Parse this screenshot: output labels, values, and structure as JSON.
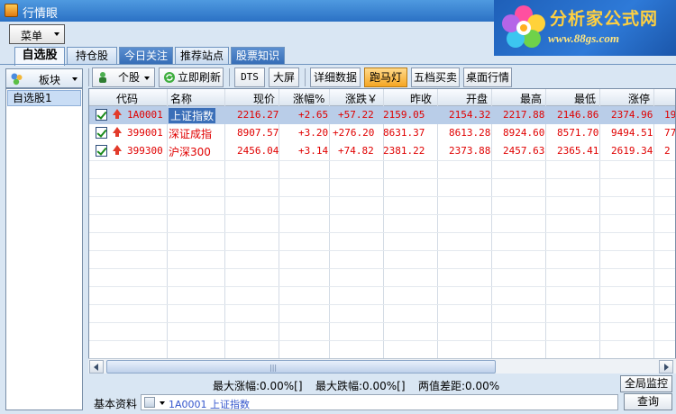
{
  "window": {
    "title": "行情眼"
  },
  "banner": {
    "brand": "分析家公式网",
    "url": "www.88gs.com"
  },
  "menu": {
    "label": "菜单"
  },
  "tabs": [
    {
      "label": "自选股",
      "active": true
    },
    {
      "label": "持仓股"
    },
    {
      "label": "今日关注"
    },
    {
      "label": "推荐站点"
    },
    {
      "label": "股票知识"
    }
  ],
  "left_panel": {
    "board_button": "板块",
    "groups": [
      {
        "label": "自选股1"
      }
    ]
  },
  "toolbar": {
    "stock_dropdown": "个股",
    "refresh": "立即刷新",
    "dts": "DTS",
    "big_screen": "大屏",
    "detail": "详细数据",
    "marquee": "跑马灯",
    "five_levels": "五档买卖",
    "desktop_quotes": "桌面行情"
  },
  "table": {
    "columns": [
      "代码",
      "名称",
      "现价",
      "涨幅%",
      "涨跌￥",
      "昨收",
      "开盘",
      "最高",
      "最低",
      "涨停"
    ],
    "rows": [
      {
        "code": "1A0001",
        "name": "上证指数",
        "price": "2216.27",
        "pct": "+2.65",
        "chg": "+57.22",
        "prev": "2159.05",
        "open": "2154.32",
        "high": "2217.88",
        "low": "2146.86",
        "limit": "2374.96",
        "extra": "19"
      },
      {
        "code": "399001",
        "name": "深证成指",
        "price": "8907.57",
        "pct": "+3.20",
        "chg": "+276.20",
        "prev": "8631.37",
        "open": "8613.28",
        "high": "8924.60",
        "low": "8571.70",
        "limit": "9494.51",
        "extra": "77"
      },
      {
        "code": "399300",
        "name": "沪深300",
        "price": "2456.04",
        "pct": "+3.14",
        "chg": "+74.82",
        "prev": "2381.22",
        "open": "2373.88",
        "high": "2457.63",
        "low": "2365.41",
        "limit": "2619.34",
        "extra": "2"
      }
    ]
  },
  "status": {
    "max_rise": "最大涨幅:0.00%[]",
    "max_fall": "最大跌幅:0.00%[]",
    "diff": "两值差距:0.00%",
    "global_monitor": "全局监控"
  },
  "bottom": {
    "label": "基本资料",
    "quick_value": "1A0001 上证指数",
    "query": "查询"
  },
  "colors": {
    "rise": "#e00000",
    "selected_row": "#b9cde8",
    "title_bar": "#2b71c4"
  }
}
